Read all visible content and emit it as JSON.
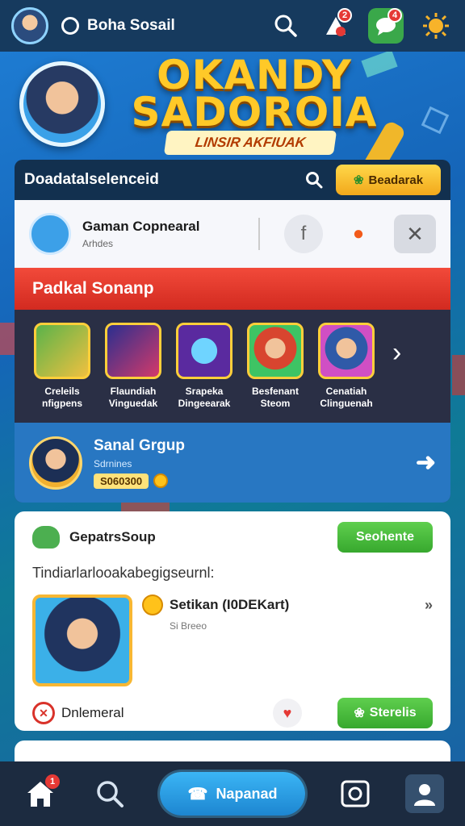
{
  "topbar": {
    "title": "Boha Sosail",
    "notification_badge": "2",
    "chat_badge": "4",
    "icons": [
      "profile-avatar",
      "status-circle-icon",
      "search-icon",
      "alert-icon",
      "chat-icon",
      "settings-sun-icon"
    ]
  },
  "hero": {
    "title_line1": "OKANDY",
    "title_line2": "SADOROIA",
    "subtitle": "LINSIR AKFIUAK"
  },
  "search_panel": {
    "text": "Doadatalselenceid",
    "button": "Beadarak"
  },
  "profile": {
    "name": "Gaman Copnearal",
    "sub": "Arhdes"
  },
  "games_section": {
    "title": "Padkal Sonanp",
    "games": [
      {
        "line1": "Creleils",
        "line2": "nfigpens"
      },
      {
        "line1": "Flaundiah",
        "line2": "Vinguedak"
      },
      {
        "line1": "Srapeka",
        "line2": "Dingeearak"
      },
      {
        "line1": "Besfenant",
        "line2": "Steom"
      },
      {
        "line1": "Cenatiah",
        "line2": "Clinguenah"
      }
    ]
  },
  "group": {
    "name": "Sanal Grgup",
    "sub": "Sdrnines",
    "coins": "S060300"
  },
  "feed": {
    "title": "GepatrsSoup",
    "button": "Seohente",
    "description": "Tindiarlarlooakabegigseurnl:",
    "item_title": "Setikan (I0DEKart)",
    "item_sub": "Si Breeo",
    "foot_label": "Dnlemeral",
    "action_button": "Sterelis"
  },
  "bottom_nav": {
    "home_badge": "1",
    "call_button": "Napanad"
  },
  "colors": {
    "accent_blue": "#1d86d1",
    "red_banner": "#e23a2d",
    "gold": "#ffc928",
    "green": "#37a82e"
  }
}
